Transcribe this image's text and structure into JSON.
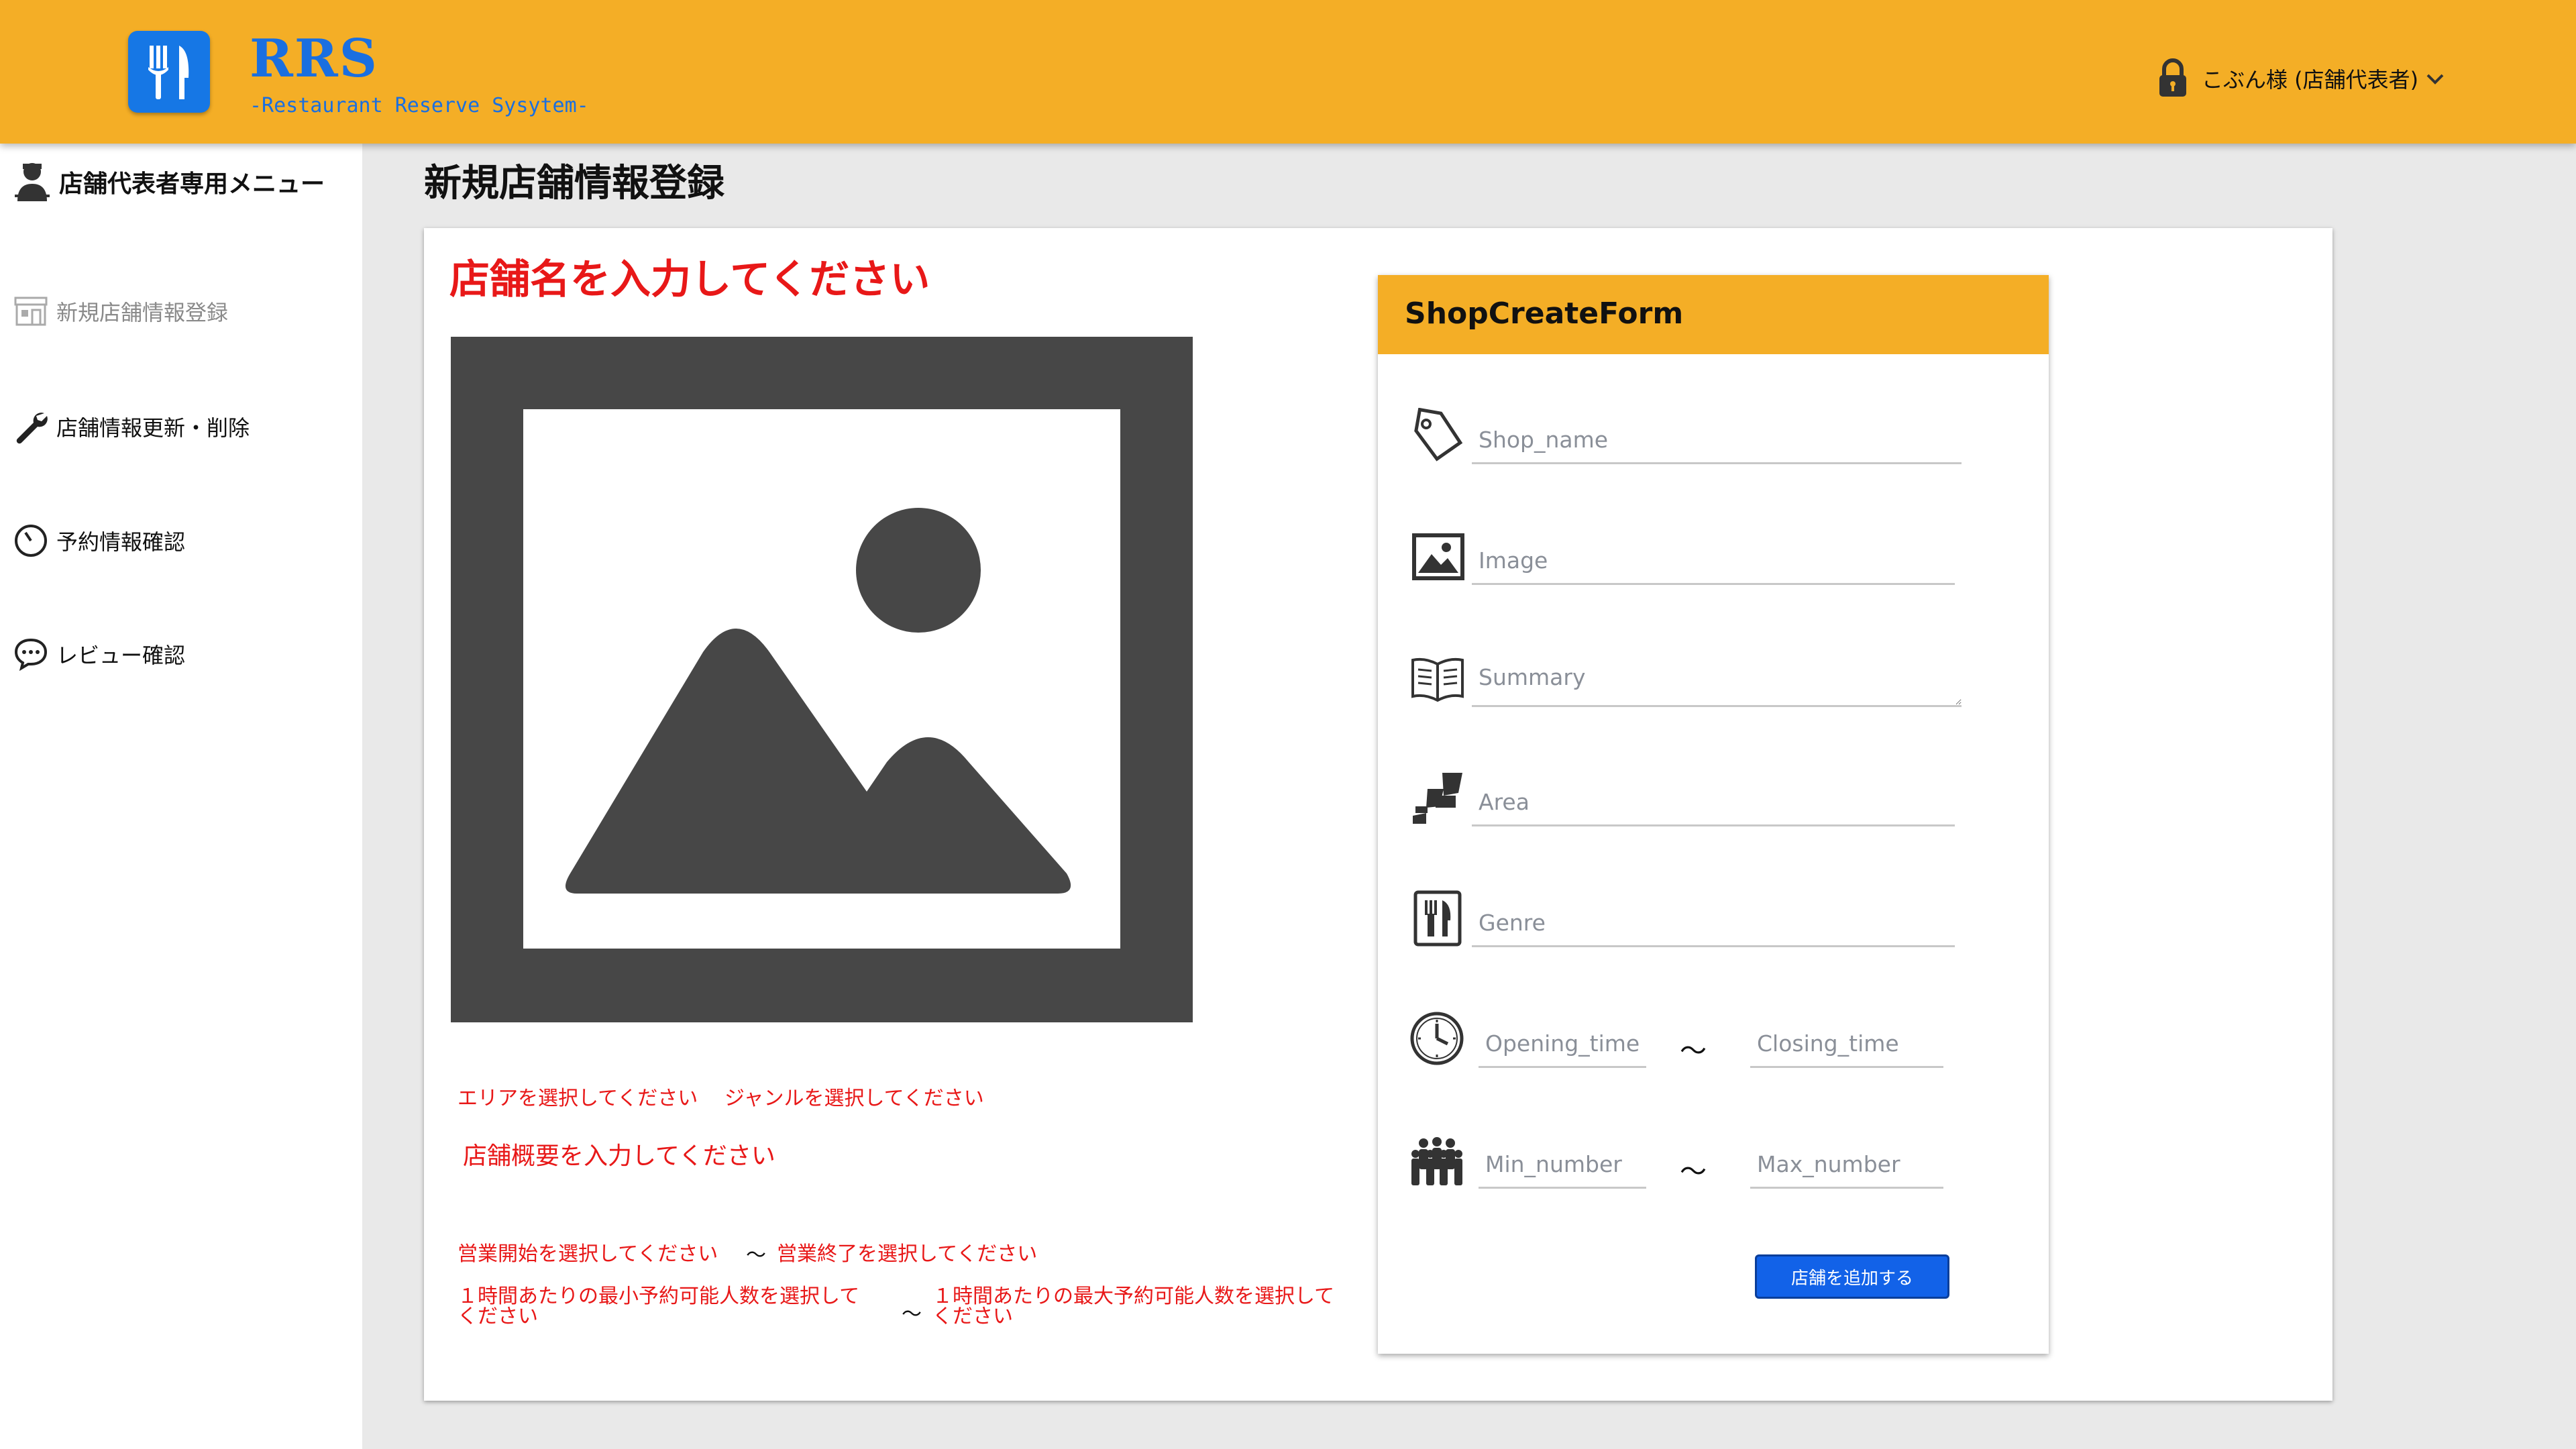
{
  "header": {
    "brand": "RRS",
    "brand_sub": "-Restaurant Reserve Sysytem-",
    "user_label": "こぶん様 (店舗代表者)",
    "colors": {
      "bar": "#f4ae26",
      "brand": "#1a6fe0"
    }
  },
  "sidebar": {
    "heading": "店舗代表者専用メニュー",
    "items": [
      {
        "label": "新規店舗情報登録",
        "icon": "shop-icon",
        "active": true
      },
      {
        "label": "店舗情報更新・削除",
        "icon": "wrench-icon"
      },
      {
        "label": "予約情報確認",
        "icon": "clock-icon"
      },
      {
        "label": "レビュー確認",
        "icon": "chat-bubble-icon"
      }
    ]
  },
  "main": {
    "title": "新規店舗情報登録"
  },
  "preview": {
    "name_prompt": "店舗名を入力してください",
    "area_prompt": "エリアを選択してください",
    "genre_prompt": "ジャンルを選択してください",
    "summary_prompt": "店舗概要を入力してください",
    "opening_prompt": "営業開始を選択してください",
    "tilde": "〜",
    "closing_prompt": "営業終了を選択してください",
    "min_prompt_line1": "１時間あたりの最小予約可能人数を選択して",
    "min_prompt_line2": "ください",
    "max_prompt_line1": "１時間あたりの最大予約可能人数を選択して",
    "max_prompt_line2": "ください",
    "error_color": "#e81818"
  },
  "form": {
    "title": "ShopCreateForm",
    "shop_name_placeholder": "Shop_name",
    "image_placeholder": "Image",
    "summary_placeholder": "Summary",
    "area_placeholder": "Area",
    "genre_placeholder": "Genre",
    "opening_placeholder": "Opening_time",
    "closing_placeholder": "Closing_time",
    "min_placeholder": "Min_number",
    "max_placeholder": "Max_number",
    "tilde": "〜",
    "submit_label": "店舗を追加する"
  }
}
